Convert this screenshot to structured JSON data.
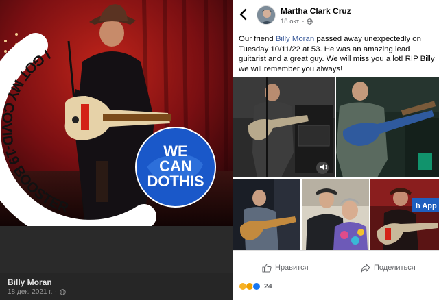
{
  "left_panel": {
    "badge": {
      "ring_text": "I GOT MY COVID-19 BOOSTER",
      "circle_lines": [
        "WE",
        "CAN",
        "DO",
        "THIS"
      ],
      "ring_color": "#ffffff",
      "circle_color": "#1a58c9",
      "text_color": "#111111"
    },
    "footer": {
      "name": "Billy Moran",
      "date": "18 дек. 2021 г. ·",
      "privacy_icon": "globe-icon"
    }
  },
  "post": {
    "back_icon": "chevron-left-icon",
    "author": "Martha Clark Cruz",
    "date": "18 окт. ·",
    "privacy_icon": "globe-icon",
    "more_icon": "more-dots-icon",
    "text_before": "Our friend ",
    "mention": "Billy Moran",
    "text_after": " passed away unexpectedly on Tuesday 10/11/22 at 53. He was an amazing lead guitarist and a great guy. We will miss you a lot! RIP Billy we will remember you always!",
    "photos_overlay_icon": "volume-icon",
    "actions": {
      "like_label": "Нравится",
      "like_icon": "thumbs-up-icon",
      "share_label": "Поделиться",
      "share_icon": "share-arrow-icon"
    },
    "reactions": {
      "count": "24",
      "icons": [
        "care-icon",
        "sad-icon",
        "like-icon"
      ]
    },
    "colors": {
      "link": "#385898",
      "meta": "#65676b"
    }
  }
}
